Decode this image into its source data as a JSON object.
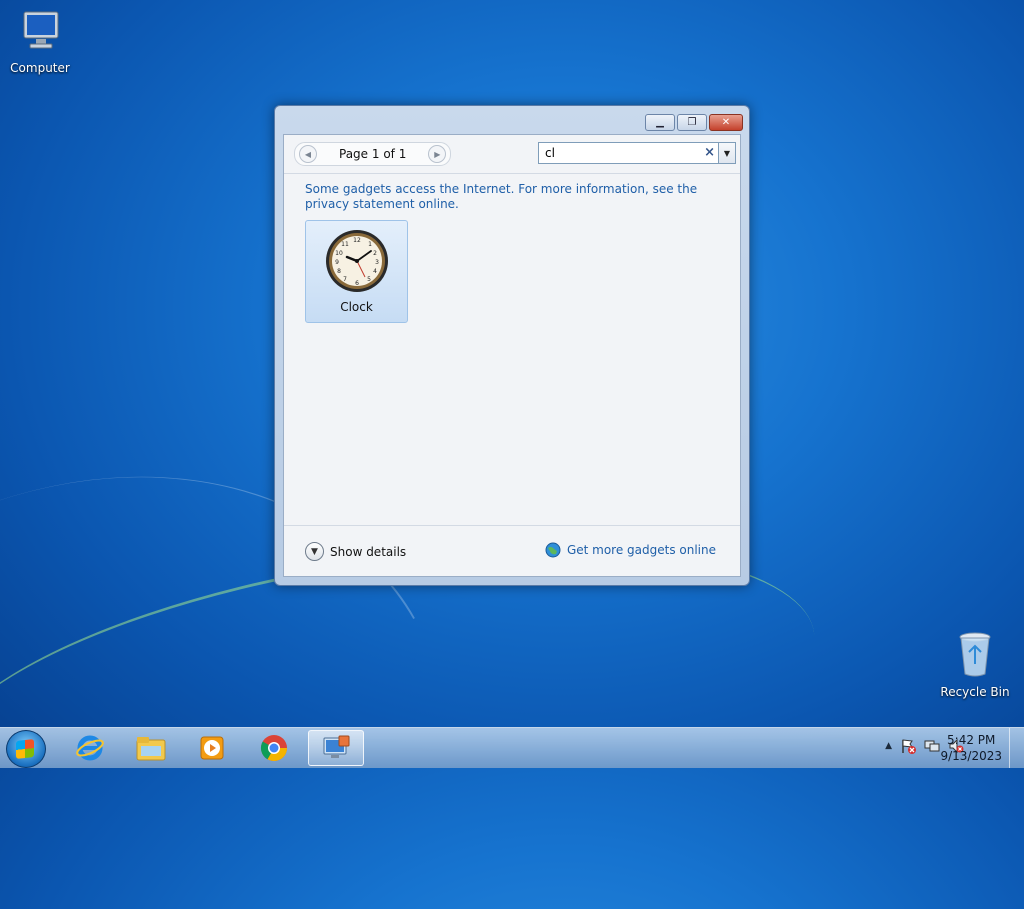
{
  "desktop": {
    "icons": [
      {
        "label": "Computer"
      },
      {
        "label": "Recycle Bin"
      }
    ]
  },
  "window": {
    "pager": {
      "text": "Page 1 of 1"
    },
    "search": {
      "value": "cl",
      "clear_glyph": "×"
    },
    "notice": "Some gadgets access the Internet.  For more information, see the privacy statement online.",
    "gadgets": [
      {
        "label": "Clock",
        "icon": "clock-icon"
      }
    ],
    "footer": {
      "show_details": "Show details",
      "get_more": "Get more gadgets online"
    }
  },
  "taskbar": {
    "clock": {
      "time": "5:42 PM",
      "date": "9/13/2023"
    },
    "apps": [
      "internet-explorer-icon",
      "windows-explorer-icon",
      "media-player-icon",
      "chrome-icon",
      "gadgets-icon"
    ]
  },
  "colors": {
    "link": "#1f5fa8",
    "tile_bg": "#c6dcf4",
    "close_btn": "#c4412c"
  }
}
